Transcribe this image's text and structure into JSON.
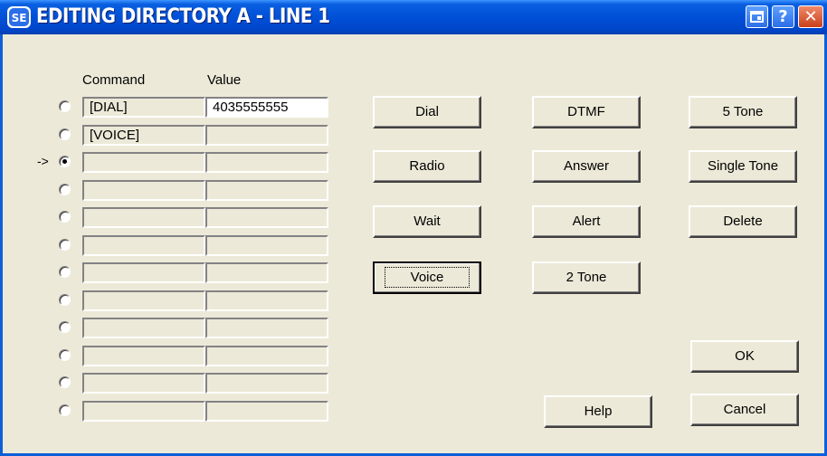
{
  "window": {
    "title": "EDITING DIRECTORY A - LINE 1",
    "controls": {
      "restore": "restore-icon",
      "help": "?",
      "close": "✕"
    }
  },
  "table": {
    "headers": {
      "command": "Command",
      "value": "Value"
    },
    "selected_marker": "->",
    "selected_row": 2,
    "rows": [
      {
        "command": "[DIAL]",
        "value": "4035555555"
      },
      {
        "command": "[VOICE]",
        "value": ""
      },
      {
        "command": "",
        "value": ""
      },
      {
        "command": "",
        "value": ""
      },
      {
        "command": "",
        "value": ""
      },
      {
        "command": "",
        "value": ""
      },
      {
        "command": "",
        "value": ""
      },
      {
        "command": "",
        "value": ""
      },
      {
        "command": "",
        "value": ""
      },
      {
        "command": "",
        "value": ""
      },
      {
        "command": "",
        "value": ""
      },
      {
        "command": "",
        "value": ""
      }
    ]
  },
  "buttons": {
    "dial": "Dial",
    "dtmf": "DTMF",
    "five_tone": "5 Tone",
    "radio": "Radio",
    "answer": "Answer",
    "single_tone": "Single Tone",
    "wait": "Wait",
    "alert": "Alert",
    "delete": "Delete",
    "voice": "Voice",
    "two_tone": "2 Tone",
    "ok": "OK",
    "help": "Help",
    "cancel": "Cancel"
  },
  "colors": {
    "titlebar": "#0050d8",
    "face": "#ece9d8",
    "close": "#c8401a"
  }
}
